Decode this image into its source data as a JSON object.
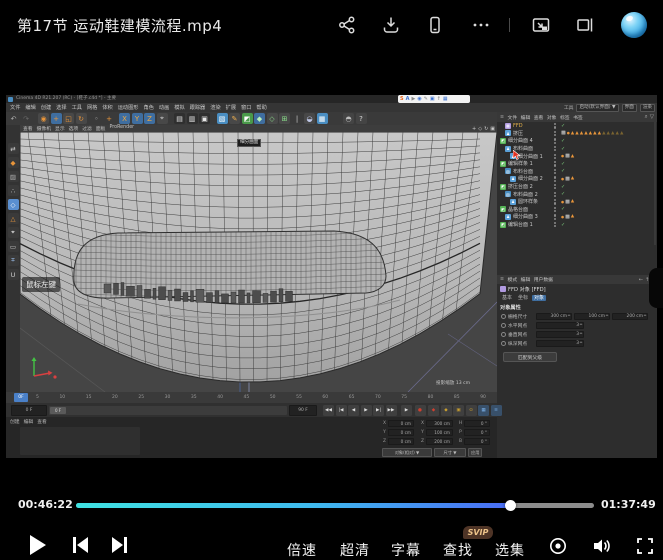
{
  "player": {
    "title": "第17节 运动鞋建模流程.mp4",
    "topbar_icons": [
      "share-icon",
      "download-icon",
      "mobile-icon",
      "more-icon",
      "pip-icon",
      "dock-right-icon",
      "avatar"
    ],
    "progress": {
      "current": "00:46:22",
      "total": "01:37:49",
      "percent": 84,
      "fill_colors": [
        "#3fe2e2",
        "#4a6cf5"
      ],
      "track_color": "#8c8c8c"
    },
    "controls": {
      "labels": [
        "倍速",
        "超清",
        "字幕",
        "查找",
        "选集"
      ],
      "svip": "SVIP",
      "icon_names": [
        "play-icon",
        "prev-icon",
        "next-icon",
        "surround-icon",
        "volume-icon",
        "fullscreen-icon"
      ]
    }
  },
  "c4d": {
    "title": "Cinema 4D R21.207 (RC) - [鞋子.c4d *] - 主要",
    "menus": [
      "文件",
      "编辑",
      "创建",
      "选择",
      "工具",
      "网格",
      "体积",
      "运动图形",
      "角色",
      "动画",
      "模拟",
      "跟踪器",
      "渲染",
      "扩展",
      "窗口",
      "帮助"
    ],
    "layout": {
      "tool": "工具",
      "preset": "启动(默认界面) ▼",
      "btn1": "界面",
      "btn2": "渲染"
    },
    "recorder_icons": [
      {
        "t": "S",
        "c": "#e8641e"
      },
      {
        "t": "A",
        "c": "#3a70d0"
      },
      {
        "t": "▶",
        "c": "#888888"
      },
      {
        "t": "◉",
        "c": "#3a70d0"
      },
      {
        "t": "✎",
        "c": "#888888"
      },
      {
        "t": "▣",
        "c": "#3a70d0"
      },
      {
        "t": "↑",
        "c": "#888888"
      },
      {
        "t": "▦",
        "c": "#3a70d0"
      }
    ],
    "toolbar": [
      {
        "t": "↶",
        "fg": "#b0b0b0",
        "bg": ""
      },
      {
        "t": "↷",
        "fg": "#6a6a6a",
        "bg": ""
      },
      {
        "gap": 5
      },
      {
        "t": "◉",
        "fg": "#e8953a",
        "bg": "#484848"
      },
      {
        "t": "+",
        "fg": "#e8953a",
        "bg": "#3f6ea0"
      },
      {
        "t": "◱",
        "fg": "#e8953a",
        "bg": "#484848"
      },
      {
        "t": "↻",
        "fg": "#e8953a",
        "bg": "#484848"
      },
      {
        "gap": 3
      },
      {
        "t": "◦",
        "fg": "#cccccc",
        "bg": ""
      },
      {
        "t": "+",
        "fg": "#e8953a",
        "bg": ""
      },
      {
        "gap": 3
      },
      {
        "t": "X",
        "fg": "#f0a840",
        "bg": "#3f6ea0"
      },
      {
        "t": "Y",
        "fg": "#f0a840",
        "bg": "#3f6ea0"
      },
      {
        "t": "Z",
        "fg": "#f0a840",
        "bg": "#3f6ea0"
      },
      {
        "t": "⌖",
        "fg": "#cccccc",
        "bg": "#484848"
      },
      {
        "gap": 5
      },
      {
        "t": "▤",
        "fg": "#e8e8e8",
        "bg": "#2f2f2f"
      },
      {
        "t": "▥",
        "fg": "#e8e8e8",
        "bg": "#2f2f2f"
      },
      {
        "t": "▣",
        "fg": "#e8e8e8",
        "bg": "#2f2f2f"
      },
      {
        "gap": 5
      },
      {
        "t": "▧",
        "fg": "#ffffff",
        "bg": "#4a8ec2"
      },
      {
        "t": "✎",
        "fg": "#f0b050",
        "bg": "#484848"
      },
      {
        "t": "◩",
        "fg": "#ffffff",
        "bg": "#4a9a4a"
      },
      {
        "t": "◆",
        "fg": "#baf0ba",
        "bg": "#3f6ea0"
      },
      {
        "t": "◇",
        "fg": "#8adf8a",
        "bg": "#484848"
      },
      {
        "t": "⊞",
        "fg": "#8adf8a",
        "bg": "#484848"
      },
      {
        "t": "|",
        "fg": "#cccccc",
        "bg": ""
      },
      {
        "t": "◒",
        "fg": "#c0c8e8",
        "bg": "#484848"
      },
      {
        "t": "▦",
        "fg": "#ffffff",
        "bg": "#4a8ec2"
      },
      {
        "gap": 14
      },
      {
        "t": "◓",
        "fg": "#bbbbbb",
        "bg": "#444444"
      },
      {
        "t": "?",
        "fg": "#dddddd",
        "bg": "#444444"
      }
    ],
    "palette": [
      {
        "t": "⇄",
        "fg": "#cccccc",
        "bg": "#3a3a3a"
      },
      {
        "t": "◆",
        "fg": "#e8953a",
        "bg": "#3a3a3a"
      },
      {
        "t": "▨",
        "fg": "#b0b0b0",
        "bg": "#3a3a3a"
      },
      {
        "t": "∴",
        "fg": "#cccccc",
        "bg": "#3a3a3a"
      },
      {
        "t": "◇",
        "fg": "#ffffff",
        "bg": "#5a8fd0"
      },
      {
        "t": "△",
        "fg": "#e8953a",
        "bg": "#3a3a3a"
      },
      {
        "t": "⌖",
        "fg": "#f0f0f0",
        "bg": "#3a3a3a"
      },
      {
        "t": "▭",
        "fg": "#cccccc",
        "bg": "#3a3a3a"
      },
      {
        "t": "⌗",
        "fg": "#9cc0ee",
        "bg": "#3a3a3a"
      },
      {
        "t": "U",
        "fg": "#cccccc",
        "bg": "#3a3a3a"
      }
    ],
    "viewport": {
      "menus": [
        "查看",
        "摄像机",
        "显示",
        "选项",
        "过滤",
        "面板",
        "ProRender"
      ],
      "view_icons": [
        "pan-icon",
        "zoom-icon",
        "rotate-icon",
        "maximize-icon"
      ],
      "view_glyphs": [
        "+",
        "◇",
        "↻",
        "▣"
      ],
      "tooltip": "细分曲面",
      "mouse_hint": "鼠标左键",
      "scale_info": "投影缩放  13 cm"
    },
    "timeline": {
      "current": "0F",
      "frames": [
        5,
        10,
        15,
        20,
        25,
        30,
        35,
        40,
        45,
        50,
        55,
        60,
        65,
        70,
        75,
        80,
        85,
        90
      ],
      "left_field": "0 F",
      "right_field": "90 F",
      "slider_label": "0 F",
      "buttons": [
        "◀◀",
        "|◀",
        "◀",
        "▶",
        "▶|",
        "▶▶"
      ],
      "extra_button": "▶",
      "record": [
        "●",
        "◆"
      ],
      "key_icons": [
        "◆",
        "▣",
        "⊙"
      ],
      "blue_icons": [
        "▦",
        "≡"
      ]
    },
    "object_manager": {
      "menus": [
        "文件",
        "编辑",
        "查看",
        "对象",
        "标签",
        "书签"
      ],
      "items": [
        {
          "ind": 1,
          "icc": "#b09ae0",
          "g": "▦",
          "name": "FFD",
          "nc": "#e8b44a",
          "tags": [
            "chk"
          ]
        },
        {
          "ind": 1,
          "icc": "#5aa0d8",
          "g": "♟",
          "name": "挤压",
          "tags": [
            "x",
            "od",
            "t",
            "t",
            "t",
            "t",
            "t",
            "t",
            "t",
            "to",
            "to",
            "to",
            "to",
            "to"
          ]
        },
        {
          "ind": 0,
          "icc": "#56b456",
          "g": "◩",
          "name": "细分曲面 4",
          "tags": [
            "chk"
          ],
          "cursor": true
        },
        {
          "ind": 1,
          "icc": "#5aa0d8",
          "g": "♟",
          "name": "布料曲面",
          "tags": [
            "chk"
          ]
        },
        {
          "ind": 2,
          "icc": "#5aa0d8",
          "g": "♟",
          "name": "细分曲面 1",
          "tags": [
            "od",
            "x",
            "t"
          ]
        },
        {
          "ind": 0,
          "icc": "#56b456",
          "g": "◩",
          "name": "编辑样条 1",
          "tags": [
            "chk"
          ]
        },
        {
          "ind": 1,
          "icc": "#4a8ec2",
          "g": "▧",
          "name": "布料台面",
          "tags": [
            "chk"
          ]
        },
        {
          "ind": 2,
          "icc": "#5aa0d8",
          "g": "♟",
          "name": "细分曲面 2",
          "tags": [
            "od",
            "x",
            "t"
          ]
        },
        {
          "ind": 0,
          "icc": "#56b456",
          "g": "◩",
          "name": "挤压台面 2",
          "tags": [
            "chk"
          ]
        },
        {
          "ind": 1,
          "icc": "#4a8ec2",
          "g": "▧",
          "name": "布料曲面 2",
          "tags": [
            "chk"
          ]
        },
        {
          "ind": 2,
          "icc": "#5aa0d8",
          "g": "♟",
          "name": "圆环样条",
          "tags": [
            "od",
            "x",
            "t"
          ]
        },
        {
          "ind": 0,
          "icc": "#56b456",
          "g": "◩",
          "name": "晶格台面",
          "tags": [
            "chk"
          ]
        },
        {
          "ind": 1,
          "icc": "#5aa0d8",
          "g": "♟",
          "name": "细分曲面 3",
          "tags": [
            "od",
            "x",
            "t"
          ]
        },
        {
          "ind": 0,
          "icc": "#56b456",
          "g": "◩",
          "name": "编辑台面 1",
          "tags": [
            "chk"
          ]
        }
      ]
    },
    "attributes": {
      "menus": [
        "模式",
        "编辑",
        "用户数据"
      ],
      "title": "FFD 对象 [FFD]",
      "tabs": [
        "基本",
        "坐标",
        "对象"
      ],
      "active_tab": 2,
      "section": "对象属性",
      "rows": [
        {
          "label": "栅格尺寸",
          "values": [
            "300 cm",
            "100 cm",
            "200 cm"
          ]
        },
        {
          "label": "水平网点",
          "values": [
            "3"
          ]
        },
        {
          "label": "垂直网点",
          "values": [
            "3"
          ]
        },
        {
          "label": "纵深网点",
          "values": [
            "3"
          ]
        }
      ],
      "apply": "匹配到父级"
    },
    "coordinates": {
      "cols": [
        [
          [
            "X",
            "0 cm"
          ],
          [
            "Y",
            "0 cm"
          ],
          [
            "Z",
            "0 cm"
          ]
        ],
        [
          [
            "X",
            "300 cm"
          ],
          [
            "Y",
            "100 cm"
          ],
          [
            "Z",
            "200 cm"
          ]
        ],
        [
          [
            "H",
            "0 °"
          ],
          [
            "P",
            "0 °"
          ],
          [
            "B",
            "0 °"
          ]
        ]
      ],
      "buttons": [
        "对象(相对) ▼",
        "尺寸 ▼",
        "应用"
      ]
    },
    "materials_menus": [
      "创建",
      "编辑",
      "查看"
    ]
  }
}
